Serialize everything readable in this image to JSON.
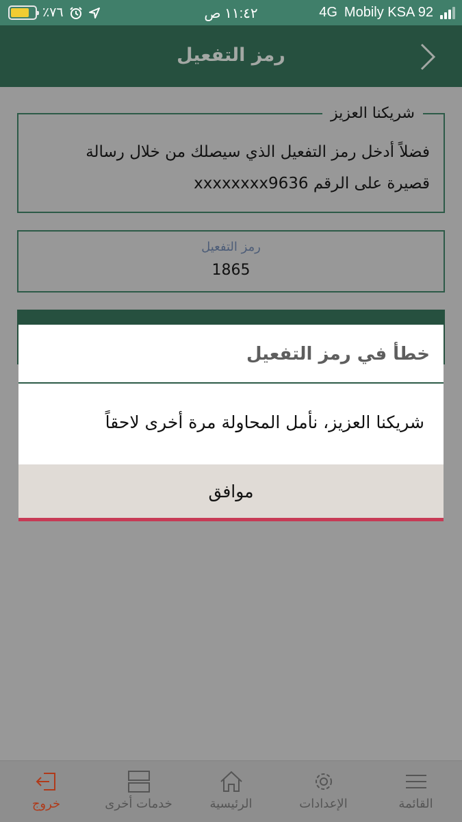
{
  "status_bar": {
    "battery_text": "٪٧٦",
    "time": "١١:٤٢ ص",
    "network": "4G",
    "carrier": "Mobily KSA 92",
    "battery_level": 0.76
  },
  "header": {
    "title": "رمز التفعيل"
  },
  "info_box": {
    "legend": "شريكنا العزيز",
    "line1": "فضلاً أدخل رمز التفعيل الذي سيصلك من خلال رسالة",
    "line2": "قصيرة على الرقم xxxxxxxx9636"
  },
  "activation_field": {
    "label": "رمز التفعيل",
    "value": "1865"
  },
  "alert": {
    "title": "خطأ في رمز التفعيل",
    "message": "شريكنا العزيز، نأمل المحاولة مرة أخرى لاحقاً",
    "ok_label": "موافق"
  },
  "tab_bar": {
    "items": [
      {
        "label": "خروج",
        "icon": "logout-icon",
        "active": true
      },
      {
        "label": "خدمات أخرى",
        "icon": "other-services-icon"
      },
      {
        "label": "الرئيسية",
        "icon": "home-icon"
      },
      {
        "label": "الإعدادات",
        "icon": "gear-icon"
      },
      {
        "label": "القائمة",
        "icon": "menu-icon"
      }
    ]
  },
  "colors": {
    "status_bar": "#407f6a",
    "nav_bar": "#26503f",
    "overlay_bg": "#989898",
    "alert_button": "#e0dbd6",
    "accent_red": "#c73a55",
    "active_tab": "#b03a1a"
  }
}
